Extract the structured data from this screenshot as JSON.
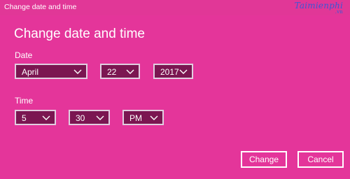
{
  "window": {
    "title": "Change date and time"
  },
  "watermark": {
    "text": "Taimienphi",
    "sub": ".vn"
  },
  "heading": "Change date and time",
  "date": {
    "label": "Date",
    "month": "April",
    "day": "22",
    "year": "2017"
  },
  "time": {
    "label": "Time",
    "hour": "5",
    "minute": "30",
    "period": "PM"
  },
  "buttons": {
    "change": "Change",
    "cancel": "Cancel"
  },
  "colors": {
    "background": "#e4359a",
    "field_fill": "#7b1651",
    "field_border": "#e0cfe0",
    "text": "#ffffff"
  },
  "icons": [
    "chevron-down-icon"
  ]
}
